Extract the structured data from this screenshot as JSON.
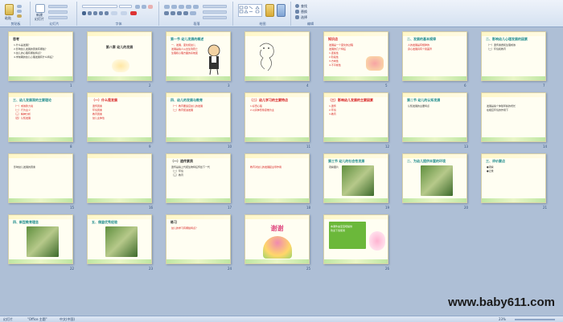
{
  "ribbon": {
    "groups": [
      {
        "label": "剪贴板"
      },
      {
        "label": "幻灯片"
      },
      {
        "label": "字体"
      },
      {
        "label": "段落"
      },
      {
        "label": "绘图"
      },
      {
        "label": "编辑"
      }
    ],
    "new_slide_label": "新建",
    "slide_label": "幻灯片",
    "paste_label": "粘贴",
    "find_label": "查找",
    "replace_label": "替换",
    "select_label": "选择"
  },
  "slides": [
    {
      "num": "1",
      "title": "思考",
      "lines": [
        "1.什么是发展？",
        "2.影响幼儿发展的因素有哪些？",
        "3.幼儿的心理有哪些特点？",
        "4.学前期的幼儿心理发展有什么特征？"
      ]
    },
    {
      "num": "2",
      "title": "第八章  幼儿的发展",
      "lines": []
    },
    {
      "num": "3",
      "title": "第一节  幼儿发展的概述",
      "lines": [
        "一、发展、变化和幼儿",
        "发展是指人从出生到死亡",
        "生理和心理方面的系统变化"
      ]
    },
    {
      "num": "4",
      "title": "",
      "lines": []
    },
    {
      "num": "5",
      "title": "知识点",
      "lines": [
        "发展是一个变化的过程",
        "发展的几个特征",
        "1.连续性",
        "2.阶段性",
        "3.方向性",
        "4.不平衡性"
      ]
    },
    {
      "num": "6",
      "title": "二、发展的基本规律",
      "lines": [
        "人的发展是有规律的",
        "身心发展具有个别差异"
      ]
    },
    {
      "num": "7",
      "title": "二、影响幼儿心理发展的因素",
      "lines": [
        "（一）遗传素质和生理成熟",
        "（二）环境和教育"
      ]
    },
    {
      "num": "8",
      "title": "三、幼儿发展观的主要理论",
      "lines": [
        "（一）成熟势力说",
        "（二）行为主义",
        "（三）精神分析",
        "（四）认知发展"
      ]
    },
    {
      "num": "9",
      "title": "（一）什么是发展",
      "lines": [
        "遗传因素",
        "环境因素",
        "教育因素",
        "幼儿主体性"
      ]
    },
    {
      "num": "10",
      "title": "四、幼儿的发展与教育",
      "lines": [
        "（一）教育要适应幼儿的发展",
        "（二）教育促进发展"
      ]
    },
    {
      "num": "11",
      "title": "（二）幼儿学习的主要特点",
      "lines": [
        "1.好奇心强",
        "2.以具体形象思维为主"
      ]
    },
    {
      "num": "12",
      "title": "（三）影响幼儿发展的主要因素",
      "lines": [
        "1.遗传",
        "2.环境",
        "3.教育"
      ]
    },
    {
      "num": "13",
      "title": "第二节  幼儿的认知发展",
      "lines": [
        "认知发展的主要特点"
      ]
    },
    {
      "num": "14",
      "title": "",
      "lines": [
        "发展是指个体随年龄的增长",
        "在相应环境的作用下"
      ]
    },
    {
      "num": "15",
      "title": "",
      "lines": [
        "影响幼儿发展的因素"
      ]
    },
    {
      "num": "16",
      "title": "",
      "lines": []
    },
    {
      "num": "17",
      "title": "（一）遗传素质",
      "lines": [
        "遗传是指上代把生物特征传给下一代",
        "（二）环境",
        "（三）教育"
      ]
    },
    {
      "num": "18",
      "title": "",
      "lines": [
        "教育对幼儿的发展起主导作用"
      ]
    },
    {
      "num": "19",
      "title": "第三节  幼儿的社会性发展",
      "lines": [
        "观察图片"
      ]
    },
    {
      "num": "20",
      "title": "二、为幼儿提供丰富的环境",
      "lines": []
    },
    {
      "num": "21",
      "title": "三、评价要点",
      "lines": [
        "●观察",
        "●记录"
      ]
    },
    {
      "num": "22",
      "title": "四、新型教育理念",
      "lines": []
    },
    {
      "num": "23",
      "title": "五、借鉴优秀经验",
      "lines": []
    },
    {
      "num": "24",
      "title": "练习",
      "lines": [
        "幼儿的学习有哪些特点？"
      ]
    },
    {
      "num": "25",
      "title": "谢谢",
      "lines": []
    },
    {
      "num": "26",
      "title": "",
      "lines": [
        "本课件由宝宝吧提供",
        "欢迎下载使用"
      ]
    }
  ],
  "status": {
    "slide_info": "幻灯片",
    "theme": "\"Office 主题\"",
    "language": "中文(中国)",
    "zoom": "23%"
  },
  "watermark": "www.baby611.com",
  "colors": {
    "title_teal": "#1f8c8c",
    "red": "#d61a1a",
    "dark_text": "#333333",
    "slide_bg": "#fffef2"
  }
}
